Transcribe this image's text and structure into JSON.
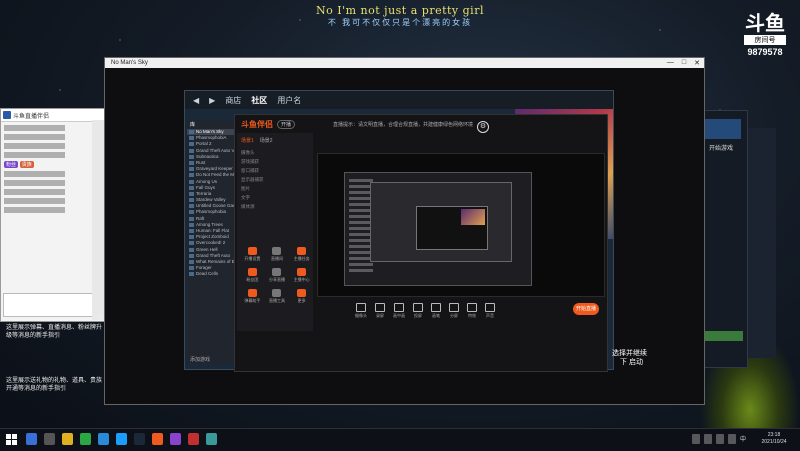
{
  "overlay": {
    "lyric_line1": "No I'm not just a pretty girl",
    "lyric_line2": "不 我可不仅仅只是个漂亮的女孩",
    "logo_mark": "斗鱼",
    "logo_sub": "房间号",
    "room_number": "9879578"
  },
  "chat": {
    "header_title": "斗鱼直播伴侣",
    "badge1": "粉丝",
    "badge2": "贵族",
    "tip1": "这里展示弹幕、直播消息、粉丝牌升级等消息的新手指引",
    "tip2": "这里展示送礼物的礼物、道具、贵族开通等消息的新手指引",
    "cursor_label": "大小"
  },
  "outer_window": {
    "title": "No Man's Sky",
    "min": "—",
    "max": "□",
    "close": "✕"
  },
  "steam": {
    "nav": [
      "商店",
      "社区",
      "用户名"
    ],
    "library_header": "库",
    "games": [
      "No Man's Sky",
      "PhasmophobiA",
      "Portal 2",
      "Grand Theft Auto V",
      "Subnautica",
      "Rust",
      "Graveyard Keeper",
      "Do Not Feed the Monkeys",
      "Among Us",
      "Fall Guys",
      "Terraria",
      "Stardew Valley",
      "Untitled Goose Game",
      "Phasmophobia",
      "Raft",
      "Among Trees",
      "Human: Fall Flat",
      "Project Zomboid",
      "Overcooked! 2",
      "Green Hell",
      "Grand Theft Auto",
      "What Remains of Edith Finch",
      "Forager",
      "Dead Cells"
    ],
    "add_game": "添加游戏"
  },
  "recorder": {
    "brand": "斗鱼伴侣",
    "live_label": "开播",
    "notice": "直播提示：请文明直播，合理合规直播，共建健康绿色网络环境",
    "tabs": [
      "场景1",
      "场景2"
    ],
    "sources": [
      "摄像头",
      "游戏捕获",
      "窗口捕获",
      "显示器捕获",
      "图片",
      "文字",
      "媒体源"
    ],
    "grid_items": [
      "开播设置",
      "直播间",
      "主播任务",
      "粉丝团",
      "分享直播",
      "主播中心",
      "弹幕助手",
      "直播工具",
      "更多"
    ],
    "toolbar": [
      "摄像头",
      "录屏",
      "画中画",
      "投屏",
      "画笔",
      "分屏",
      "特效",
      "声音"
    ],
    "start_button": "开始直播"
  },
  "right_panel": {
    "start_game": "开始游戏",
    "subtitle_line1": "选择并继续",
    "subtitle_line2": "下 启动"
  },
  "taskbar": {
    "time": "23:18",
    "date": "2021/10/24",
    "lang": "中"
  }
}
